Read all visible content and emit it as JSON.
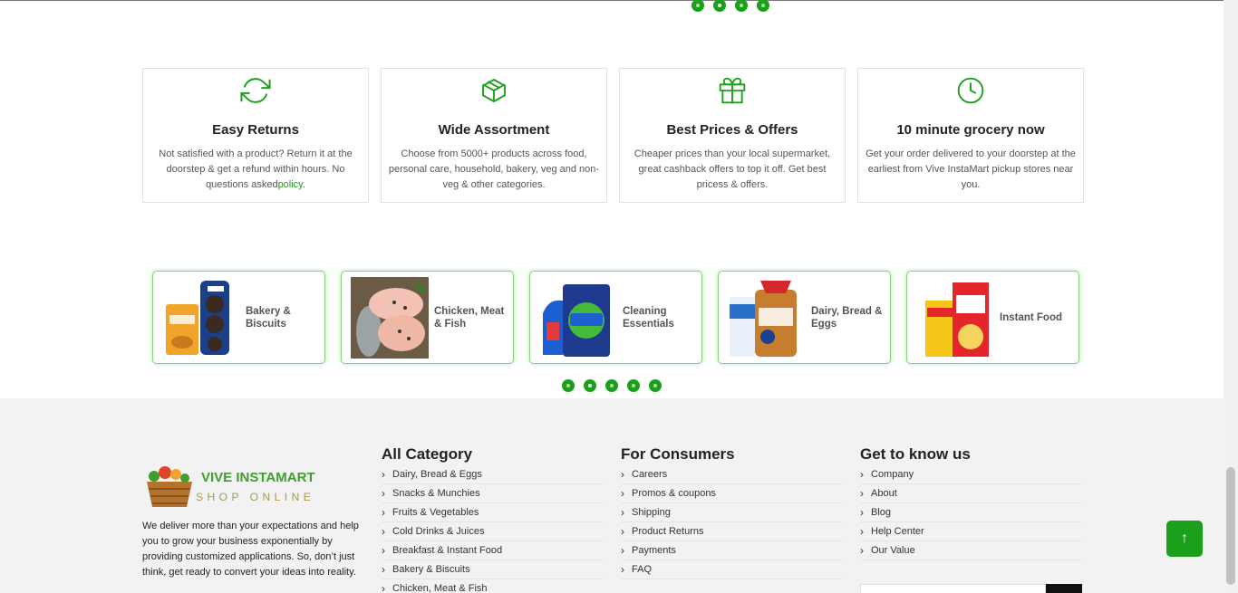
{
  "colors": {
    "accent": "#1aa01a",
    "footer_bg": "#f1f2f1"
  },
  "top_carousel": {
    "dots": 4,
    "active_index": 1
  },
  "features": [
    {
      "icon": "refresh-icon",
      "title": "Easy Returns",
      "text": "Not satisfied with a product? Return it at the doorstep & get a refund within hours. No questions asked",
      "link": "policy",
      "after": "."
    },
    {
      "icon": "box-icon",
      "title": "Wide Assortment",
      "text": "Choose from 5000+ products across food, personal care, household, bakery, veg and non-veg & other categories.",
      "link": "",
      "after": ""
    },
    {
      "icon": "gift-icon",
      "title": "Best Prices & Offers",
      "text": "Cheaper prices than your local supermarket, great cashback offers to top it off. Get best pricess & offers.",
      "link": "",
      "after": ""
    },
    {
      "icon": "clock-icon",
      "title": "10 minute grocery now",
      "text": "Get your order delivered to your doorstep at the earliest from Vive InstaMart pickup stores near you.",
      "link": "",
      "after": ""
    }
  ],
  "categories": [
    {
      "name": "Bakery & Biscuits",
      "icon": "bakery-biscuits-image"
    },
    {
      "name": "Chicken, Meat & Fish",
      "icon": "chicken-meat-fish-image"
    },
    {
      "name": "Cleaning Essentials",
      "icon": "cleaning-essentials-image"
    },
    {
      "name": "Dairy, Bread & Eggs",
      "icon": "dairy-bread-eggs-image"
    },
    {
      "name": "Instant Food",
      "icon": "instant-food-image"
    }
  ],
  "category_carousel": {
    "dots": 5,
    "active_index": 1
  },
  "footer": {
    "logo": {
      "line1": "VIVE INSTAMART",
      "line2": "SHOP ONLINE"
    },
    "about": "We deliver more than your expectations and help you to grow your business exponentially by providing customized applications. So, don’t just think, get ready to convert your ideas into reality.",
    "all_category": {
      "title": "All Category",
      "items": [
        "Dairy, Bread & Eggs",
        "Snacks & Munchies",
        "Fruits & Vegetables",
        "Cold Drinks & Juices",
        "Breakfast & Instant Food",
        "Bakery & Biscuits",
        "Chicken, Meat & Fish"
      ]
    },
    "for_consumers": {
      "title": "For Consumers",
      "items": [
        "Careers",
        "Promos & coupons",
        "Shipping",
        "Product Returns",
        "Payments",
        "FAQ"
      ]
    },
    "get_to_know": {
      "title": "Get to know us",
      "items": [
        "Company",
        "About",
        "Blog",
        "Help Center",
        "Our Value"
      ]
    }
  },
  "back_to_top": "↑"
}
